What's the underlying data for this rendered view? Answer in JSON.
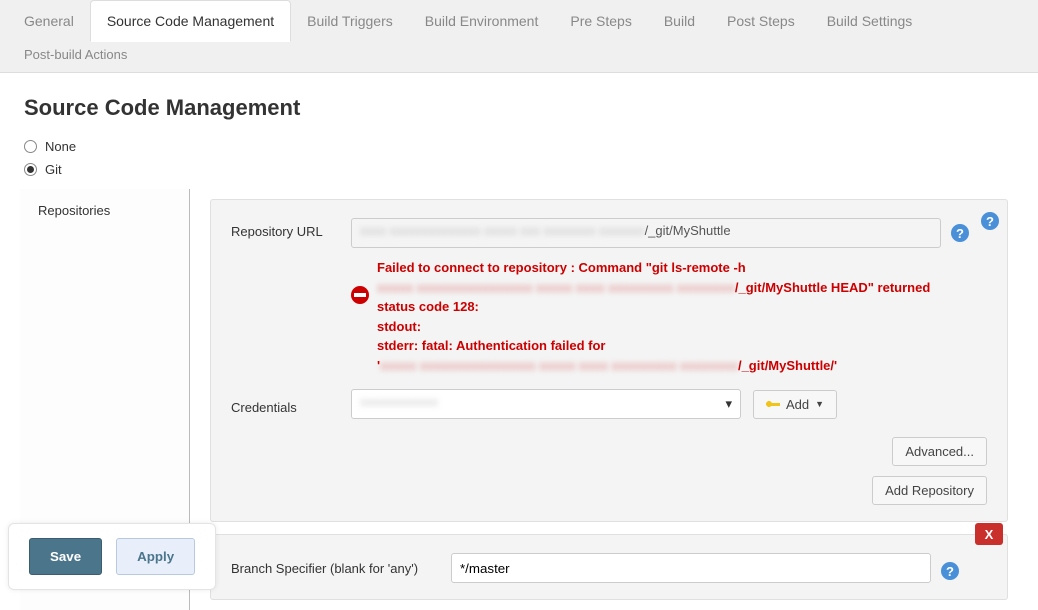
{
  "tabs": {
    "general": "General",
    "scm": "Source Code Management",
    "triggers": "Build Triggers",
    "env": "Build Environment",
    "pre": "Pre Steps",
    "build": "Build",
    "post": "Post Steps",
    "settings": "Build Settings",
    "post_actions": "Post-build Actions"
  },
  "page_title": "Source Code Management",
  "scm_options": {
    "none": "None",
    "git": "Git"
  },
  "sidebar": {
    "repositories": "Repositories"
  },
  "repo": {
    "url_label": "Repository URL",
    "url_value_obscured": "xxxx  xxxxxxxxxxxxxx  xxxxx  xxx xxxxxxxx xxxxxxx",
    "url_value_suffix": "/_git/MyShuttle",
    "credentials_label": "Credentials",
    "credentials_value_obscured": "xxxxxxxxxxxx",
    "add_label": "Add",
    "advanced_label": "Advanced...",
    "add_repo_label": "Add Repository"
  },
  "error": {
    "line1": "Failed to connect to repository : Command \"git ls-remote -h",
    "line2_obscured": "xxxxx xxxxxxxxxxxxxxxx xxxxx xxxx xxxxxxxxx xxxxxxxx",
    "line2_suffix": "/_git/MyShuttle HEAD\" returned",
    "line3": "status code 128:",
    "line4": "stdout:",
    "line5": "stderr: fatal: Authentication failed for",
    "line6_obscured": "xxxxx xxxxxxxxxxxxxxxx xxxxx xxxx xxxxxxxxx xxxxxxxx",
    "line6_suffix": "/_git/MyShuttle/'"
  },
  "branches": {
    "remove": "X",
    "label": "Branch Specifier (blank for 'any')",
    "value": "*/master"
  },
  "footer": {
    "save": "Save",
    "apply": "Apply"
  },
  "help_glyph": "?"
}
